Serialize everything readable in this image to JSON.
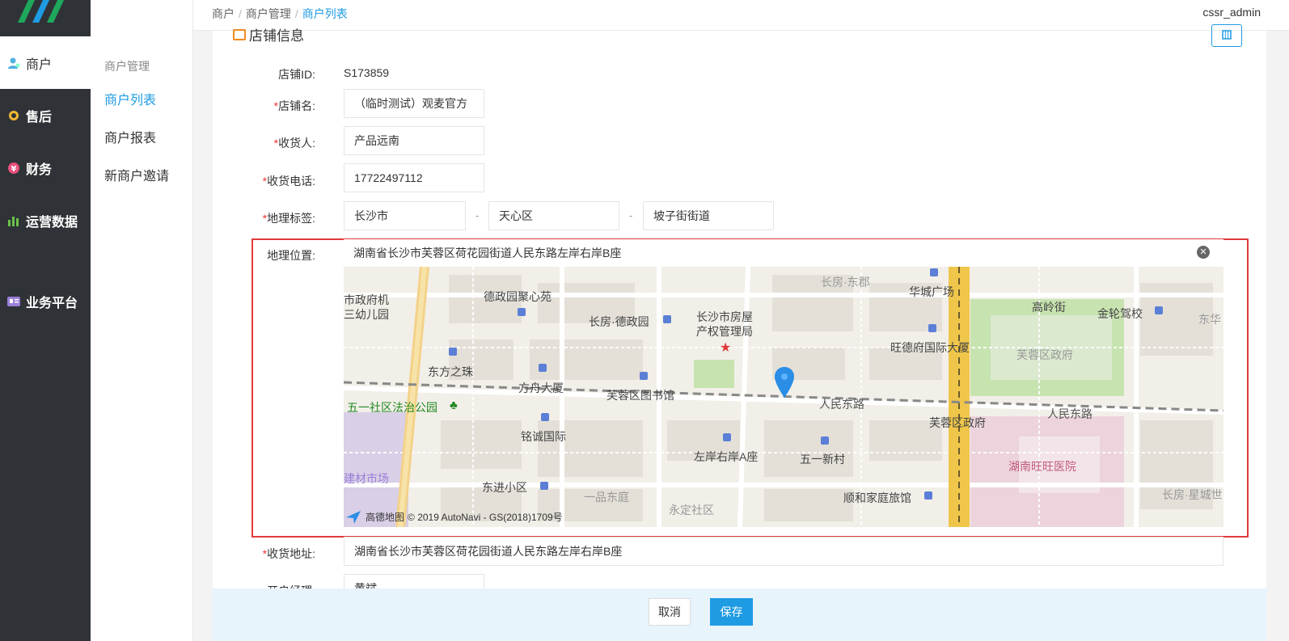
{
  "nav": {
    "items": [
      {
        "label": "商户",
        "icon": "user-icon"
      },
      {
        "label": "售后",
        "icon": "headset-icon"
      },
      {
        "label": "财务",
        "icon": "yen-icon"
      },
      {
        "label": "运营数据",
        "icon": "bar-chart-icon"
      },
      {
        "label": "业务平台",
        "icon": "id-card-icon"
      }
    ]
  },
  "subnav": {
    "title": "商户管理",
    "items": [
      "商户列表",
      "商户报表",
      "新商户邀请"
    ]
  },
  "breadcrumb": {
    "l1": "商户",
    "l2": "商户管理",
    "l3": "商户列表",
    "sep": "/"
  },
  "user": {
    "name": "cssr_admin"
  },
  "section": {
    "title": "店铺信息"
  },
  "form": {
    "store_id_label": "店铺ID:",
    "store_id_value": "S173859",
    "store_name_label": "店铺名:",
    "store_name_value": "（临时测试）观麦官方",
    "consignee_label": "收货人:",
    "consignee_value": "产品远南",
    "phone_label": "收货电话:",
    "phone_value": "17722497112",
    "geo_tag_label": "地理标签:",
    "geo_city": "长沙市",
    "geo_district": "天心区",
    "geo_street": "坡子街街道",
    "geo_sep": "-",
    "location_label": "地理位置:",
    "location_value": "湖南省长沙市芙蓉区荷花园街道人民东路左岸右岸B座",
    "ship_addr_label": "收货地址:",
    "ship_addr_value": "湖南省长沙市芙蓉区荷花园街道人民东路左岸右岸B座",
    "manager_label": "开户经理:",
    "manager_value": "黄斌",
    "required_mark": "*"
  },
  "map": {
    "labels": [
      "市政府机",
      "三幼儿园",
      "德政园聚心苑",
      "长房·德政园",
      "长沙市房屋",
      "产权管理局",
      "长房·东郡",
      "华城广场",
      "高岭街",
      "金轮驾校",
      "东华",
      "旺德府国际大厦",
      "芙蓉区政府",
      "东方之珠",
      "方舟大厦",
      "芙蓉区图书馆",
      "人民东路",
      "人民东路",
      "五一社区法治公园",
      "芙蓉区政府",
      "铭诚国际",
      "左岸右岸A座",
      "五一新村",
      "湖南旺旺医院",
      "建材市场",
      "东进小区",
      "一品东庭",
      "永定社区",
      "顺和家庭旅馆",
      "长房·星城世"
    ],
    "credit": "© 2019 AutoNavi - GS(2018)1709号",
    "brand": "高德地图"
  },
  "buttons": {
    "cancel": "取消",
    "save": "保存"
  },
  "colors": {
    "accent": "#1e9be3",
    "highlight": "#e03b3b",
    "nav_bg": "#2f3337"
  }
}
